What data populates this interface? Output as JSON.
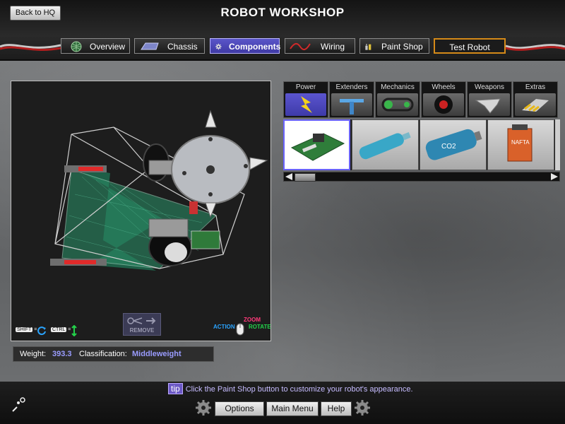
{
  "header": {
    "title": "ROBOT WORKSHOP",
    "back_label": "Back to HQ"
  },
  "tabs": [
    {
      "label": "Overview",
      "icon": "globe-icon"
    },
    {
      "label": "Chassis",
      "icon": "chassis-icon"
    },
    {
      "label": "Components",
      "icon": "gear-icon",
      "active": true
    },
    {
      "label": "Wiring",
      "icon": "wire-icon"
    },
    {
      "label": "Paint Shop",
      "icon": "paint-icon"
    },
    {
      "label": "Test Robot",
      "icon": ""
    }
  ],
  "viewport": {
    "remove_label": "REMOVE",
    "shift_label": "SHIFT",
    "ctrl_label": "CTRL",
    "eq": "=",
    "action_label": "ACTION",
    "zoom_label": "ZOOM",
    "rotate_label": "ROTATE"
  },
  "status": {
    "weight_label": "Weight:",
    "weight_value": "393.3",
    "class_label": "Classification:",
    "class_value": "Middleweight"
  },
  "categories": [
    {
      "label": "Power",
      "icon": "lightning-icon",
      "active": true
    },
    {
      "label": "Extenders",
      "icon": "extender-icon"
    },
    {
      "label": "Mechanics",
      "icon": "chain-icon"
    },
    {
      "label": "Wheels",
      "icon": "wheel-icon"
    },
    {
      "label": "Weapons",
      "icon": "blade-icon"
    },
    {
      "label": "Extras",
      "icon": "extras-icon"
    }
  ],
  "items": [
    {
      "name": "circuit-board"
    },
    {
      "name": "cylinder"
    },
    {
      "name": "co2-tank",
      "text": "CO2"
    },
    {
      "name": "battery-box",
      "text": "NAFTA"
    }
  ],
  "tip": {
    "tag": "tip",
    "text": "Click the Paint Shop button to customize your robot's appearance."
  },
  "footer": {
    "options": "Options",
    "main_menu": "Main Menu",
    "help": "Help"
  },
  "colors": {
    "accent": "#5a55c9",
    "highlight_text": "#9a9cff",
    "test_border": "#d58a18"
  }
}
